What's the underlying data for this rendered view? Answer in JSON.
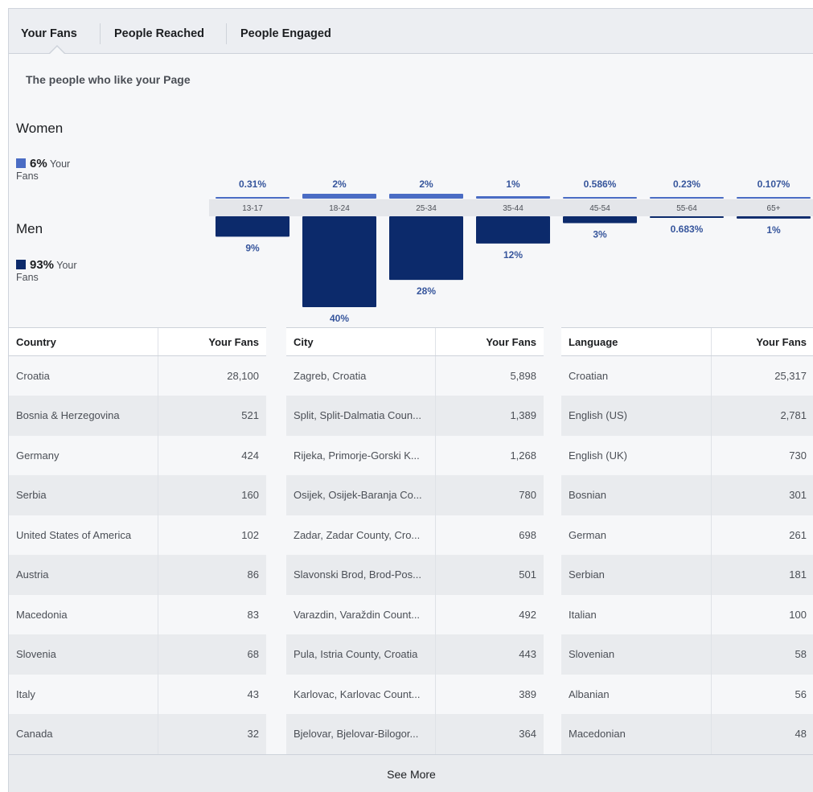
{
  "tabs": [
    {
      "label": "Your Fans"
    },
    {
      "label": "People Reached"
    },
    {
      "label": "People Engaged"
    }
  ],
  "subtitle": "The people who like your Page",
  "women": {
    "title": "Women",
    "pct": "6%",
    "your": "Your",
    "fans": "Fans",
    "color": "#4a6cc4"
  },
  "men": {
    "title": "Men",
    "pct": "93%",
    "your": "Your",
    "fans": "Fans",
    "color": "#0c2a6b"
  },
  "chart_data": {
    "type": "bar",
    "categories": [
      "13-17",
      "18-24",
      "25-34",
      "35-44",
      "45-54",
      "55-64",
      "65+"
    ],
    "series": [
      {
        "name": "Women",
        "values": [
          0.31,
          2,
          2,
          1,
          0.586,
          0.23,
          0.107
        ],
        "labels": [
          "0.31%",
          "2%",
          "2%",
          "1%",
          "0.586%",
          "0.23%",
          "0.107%"
        ]
      },
      {
        "name": "Men",
        "values": [
          9,
          40,
          28,
          12,
          3,
          0.683,
          1
        ],
        "labels": [
          "9%",
          "40%",
          "28%",
          "12%",
          "3%",
          "0.683%",
          "1%"
        ]
      }
    ]
  },
  "country_table": {
    "headers": [
      "Country",
      "Your Fans"
    ],
    "rows": [
      [
        "Croatia",
        "28,100"
      ],
      [
        "Bosnia & Herzegovina",
        "521"
      ],
      [
        "Germany",
        "424"
      ],
      [
        "Serbia",
        "160"
      ],
      [
        "United States of America",
        "102"
      ],
      [
        "Austria",
        "86"
      ],
      [
        "Macedonia",
        "83"
      ],
      [
        "Slovenia",
        "68"
      ],
      [
        "Italy",
        "43"
      ],
      [
        "Canada",
        "32"
      ]
    ]
  },
  "city_table": {
    "headers": [
      "City",
      "Your Fans"
    ],
    "rows": [
      [
        "Zagreb, Croatia",
        "5,898"
      ],
      [
        "Split, Split-Dalmatia Coun...",
        "1,389"
      ],
      [
        "Rijeka, Primorje-Gorski K...",
        "1,268"
      ],
      [
        "Osijek, Osijek-Baranja Co...",
        "780"
      ],
      [
        "Zadar, Zadar County, Cro...",
        "698"
      ],
      [
        "Slavonski Brod, Brod-Pos...",
        "501"
      ],
      [
        "Varazdin, Varaždin Count...",
        "492"
      ],
      [
        "Pula, Istria County, Croatia",
        "443"
      ],
      [
        "Karlovac, Karlovac Count...",
        "389"
      ],
      [
        "Bjelovar, Bjelovar-Bilogor...",
        "364"
      ]
    ]
  },
  "language_table": {
    "headers": [
      "Language",
      "Your Fans"
    ],
    "rows": [
      [
        "Croatian",
        "25,317"
      ],
      [
        "English (US)",
        "2,781"
      ],
      [
        "English (UK)",
        "730"
      ],
      [
        "Bosnian",
        "301"
      ],
      [
        "German",
        "261"
      ],
      [
        "Serbian",
        "181"
      ],
      [
        "Italian",
        "100"
      ],
      [
        "Slovenian",
        "58"
      ],
      [
        "Albanian",
        "56"
      ],
      [
        "Macedonian",
        "48"
      ]
    ]
  },
  "see_more": "See More"
}
